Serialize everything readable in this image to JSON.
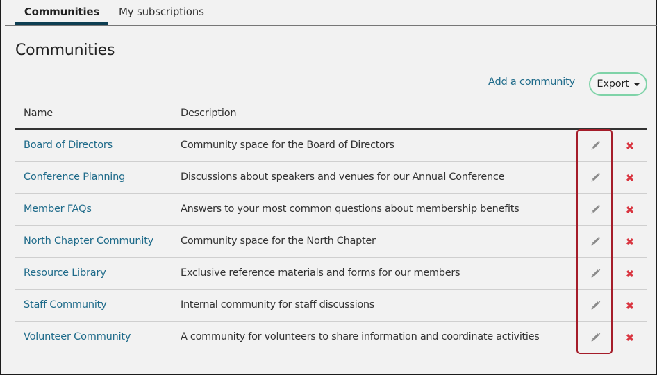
{
  "tabs": [
    {
      "label": "Communities",
      "active": true
    },
    {
      "label": "My subscriptions",
      "active": false
    }
  ],
  "page": {
    "title": "Communities",
    "add_link": "Add a community",
    "export_label": "Export"
  },
  "table": {
    "columns": [
      "Name",
      "Description"
    ],
    "rows": [
      {
        "name": "Board of Directors",
        "description": "Community space for the Board of Directors"
      },
      {
        "name": "Conference Planning",
        "description": "Discussions about speakers and venues for our Annual Conference"
      },
      {
        "name": "Member FAQs",
        "description": "Answers to your most common questions about membership benefits"
      },
      {
        "name": "North Chapter Community",
        "description": "Community space for the North Chapter"
      },
      {
        "name": "Resource Library",
        "description": "Exclusive reference materials and forms for our members"
      },
      {
        "name": "Staff Community",
        "description": "Internal community for staff discussions"
      },
      {
        "name": "Volunteer Community",
        "description": "A community for volunteers to share information and coordinate activities"
      }
    ],
    "row_actions": {
      "edit_icon": "pencil-icon",
      "delete_icon": "x-icon"
    }
  },
  "colors": {
    "link": "#1f6b8a",
    "tab_active_underline": "#0d3e52",
    "export_border": "#7fd3a8",
    "delete": "#d9343f",
    "highlight": "#a51d2a"
  }
}
